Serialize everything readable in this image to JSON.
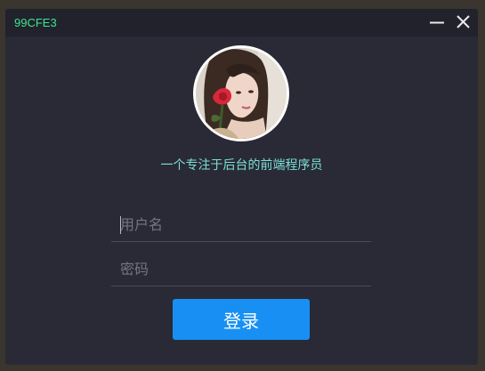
{
  "window": {
    "title": "99CFE3"
  },
  "profile": {
    "slogan": "一个专注于后台的前端程序员"
  },
  "form": {
    "username_placeholder": "用户名",
    "password_placeholder": "密码",
    "login_label": "登录"
  },
  "icons": {
    "minimize": "minimize-icon",
    "close": "close-icon"
  },
  "colors": {
    "title_text": "#3ee58c",
    "slogan_text": "#7be0d8",
    "login_button": "#1890f3",
    "window_background": "#292a35",
    "titlebar_background": "#21222b"
  }
}
